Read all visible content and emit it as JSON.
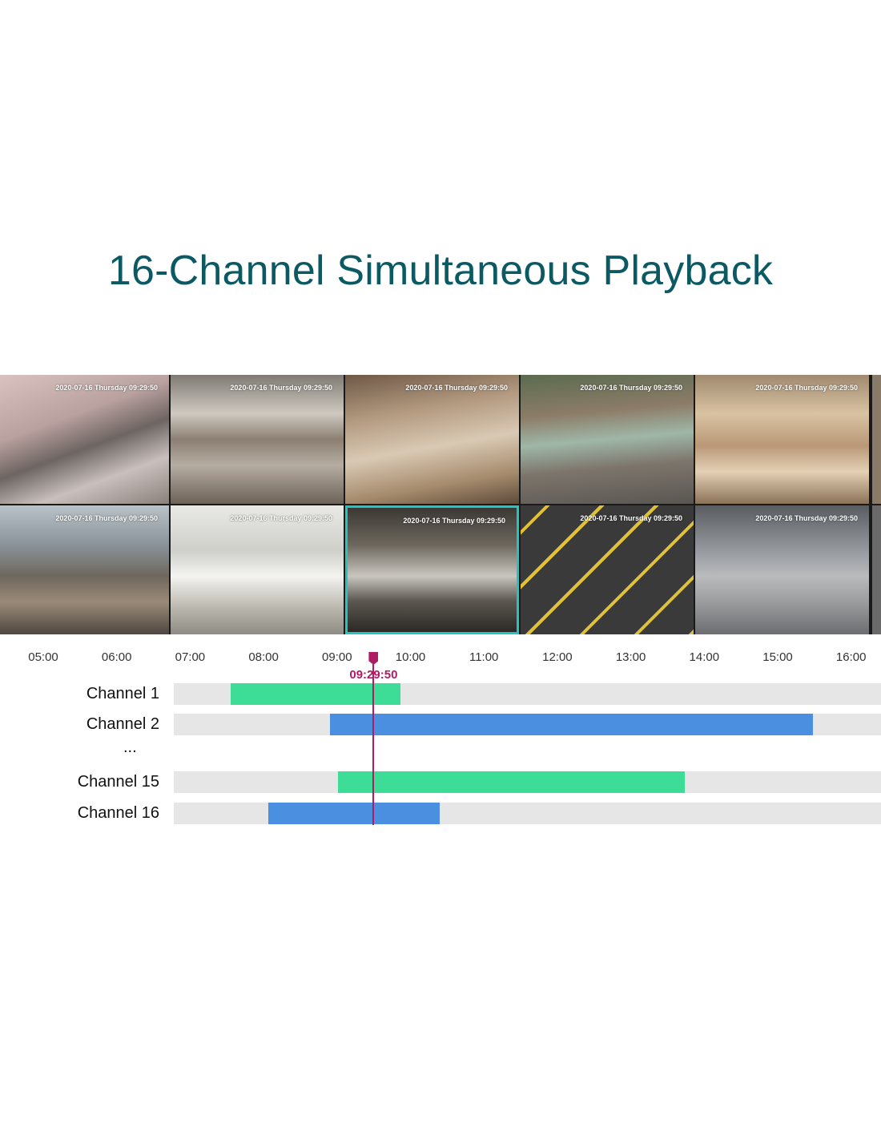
{
  "title": "16-Channel Simultaneous Playback",
  "osd_text": "2020-07-16  Thursday 09:29:50",
  "tiles": [
    {
      "name": "camera-tile-escalator",
      "scene": "escalator"
    },
    {
      "name": "camera-tile-mall-atrium",
      "scene": "atrium"
    },
    {
      "name": "camera-tile-museum-hall",
      "scene": "museum"
    },
    {
      "name": "camera-tile-storefront",
      "scene": "storefront"
    },
    {
      "name": "camera-tile-shopping-arcade",
      "scene": "arcade"
    },
    {
      "name": "camera-tile-glass-dome",
      "scene": "dome"
    },
    {
      "name": "camera-tile-white-mall",
      "scene": "whitemall"
    },
    {
      "name": "camera-tile-parking-garage",
      "scene": "garage",
      "selected": true
    },
    {
      "name": "camera-tile-parking-lot",
      "scene": "lot"
    },
    {
      "name": "camera-tile-warehouse-parking",
      "scene": "warehouse"
    }
  ],
  "timeline": {
    "ticks": [
      "05:00",
      "06:00",
      "07:00",
      "08:00",
      "09:00",
      "10:00",
      "11:00",
      "12:00",
      "13:00",
      "14:00",
      "15:00",
      "16:00"
    ],
    "cursor_time": "09:29:50",
    "ellipsis": "...",
    "colors": {
      "green": "#3ddc97",
      "blue": "#4a8fe0",
      "cursor": "#b01c63"
    },
    "channels": [
      {
        "label": "Channel 1",
        "start": "07:33",
        "end": "09:52",
        "color": "green"
      },
      {
        "label": "Channel 2",
        "start": "08:54",
        "end": "15:29",
        "color": "blue"
      },
      {
        "label": "Channel 15",
        "start": "09:01",
        "end": "13:44",
        "color": "green"
      },
      {
        "label": "Channel 16",
        "start": "08:04",
        "end": "10:24",
        "color": "blue"
      }
    ]
  }
}
